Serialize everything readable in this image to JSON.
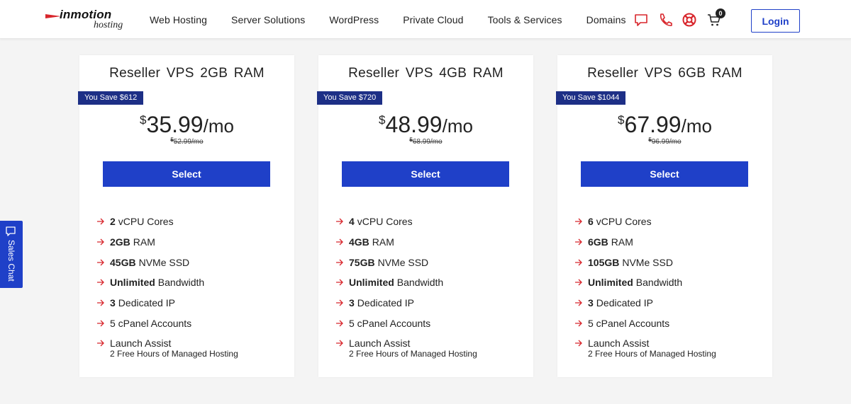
{
  "header": {
    "logo_main": "inmotion",
    "logo_sub": "hosting",
    "nav": [
      "Web Hosting",
      "Server Solutions",
      "WordPress",
      "Private Cloud",
      "Tools & Services",
      "Domains"
    ],
    "icons": [
      "chat-icon",
      "phone-icon",
      "support-icon",
      "cart-icon"
    ],
    "cart_count": "0",
    "login_label": "Login",
    "accent_color": "#1f40c8",
    "icon_color": "#d8262c"
  },
  "sales_chat": {
    "label": "Sales Chat"
  },
  "plans": [
    {
      "title": "Reseller VPS 2GB RAM",
      "save": "You Save $612",
      "currency": "$",
      "price": "35.99",
      "per": "/mo",
      "old_currency": "$",
      "old_price": "52.99/mo",
      "select_label": "Select",
      "features": [
        {
          "bold": "2",
          "text": "vCPU Cores"
        },
        {
          "bold": "2GB",
          "text": "RAM"
        },
        {
          "bold": "45GB",
          "text": "NVMe SSD"
        },
        {
          "bold": "Unlimited",
          "text": "Bandwidth"
        },
        {
          "bold": "3",
          "text": "Dedicated IP"
        },
        {
          "bold": "",
          "text": "5 cPanel Accounts"
        },
        {
          "bold": "",
          "text": "Launch Assist"
        }
      ],
      "feature_note": "2 Free Hours of Managed Hosting"
    },
    {
      "title": "Reseller VPS 4GB RAM",
      "save": "You Save $720",
      "currency": "$",
      "price": "48.99",
      "per": "/mo",
      "old_currency": "$",
      "old_price": "68.99/mo",
      "select_label": "Select",
      "features": [
        {
          "bold": "4",
          "text": "vCPU Cores"
        },
        {
          "bold": "4GB",
          "text": "RAM"
        },
        {
          "bold": "75GB",
          "text": "NVMe SSD"
        },
        {
          "bold": "Unlimited",
          "text": "Bandwidth"
        },
        {
          "bold": "3",
          "text": "Dedicated IP"
        },
        {
          "bold": "",
          "text": "5 cPanel Accounts"
        },
        {
          "bold": "",
          "text": "Launch Assist"
        }
      ],
      "feature_note": "2 Free Hours of Managed Hosting"
    },
    {
      "title": "Reseller VPS 6GB RAM",
      "save": "You Save $1044",
      "currency": "$",
      "price": "67.99",
      "per": "/mo",
      "old_currency": "$",
      "old_price": "96.99/mo",
      "select_label": "Select",
      "features": [
        {
          "bold": "6",
          "text": "vCPU Cores"
        },
        {
          "bold": "6GB",
          "text": "RAM"
        },
        {
          "bold": "105GB",
          "text": "NVMe SSD"
        },
        {
          "bold": "Unlimited",
          "text": "Bandwidth"
        },
        {
          "bold": "3",
          "text": "Dedicated IP"
        },
        {
          "bold": "",
          "text": "5 cPanel Accounts"
        },
        {
          "bold": "",
          "text": "Launch Assist"
        }
      ],
      "feature_note": "2 Free Hours of Managed Hosting"
    }
  ]
}
